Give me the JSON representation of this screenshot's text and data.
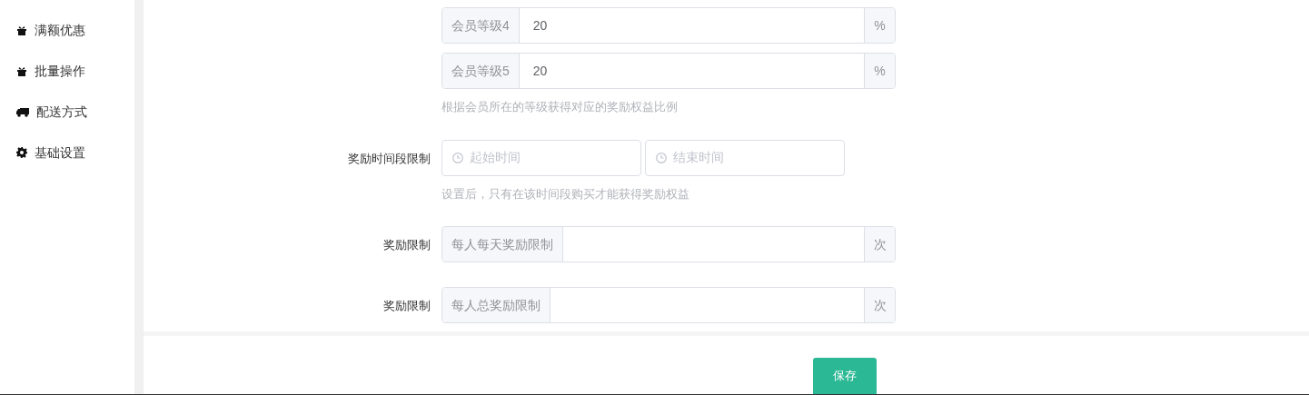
{
  "sidebar": {
    "items": [
      {
        "label": "满额优惠"
      },
      {
        "label": "批量操作"
      },
      {
        "label": "配送方式"
      },
      {
        "label": "基础设置"
      }
    ]
  },
  "member_levels": [
    {
      "prefix": "会员等级4",
      "value": "20",
      "suffix": "%"
    },
    {
      "prefix": "会员等级5",
      "value": "20",
      "suffix": "%"
    }
  ],
  "member_hint": "根据会员所在的等级获得对应的奖励权益比例",
  "time_limit": {
    "label": "奖励时间段限制",
    "start_placeholder": "起始时间",
    "end_placeholder": "结束时间",
    "hint": "设置后，只有在该时间段购买才能获得奖励权益"
  },
  "limits": [
    {
      "label": "奖励限制",
      "prefix": "每人每天奖励限制",
      "suffix": "次"
    },
    {
      "label": "奖励限制",
      "prefix": "每人总奖励限制",
      "suffix": "次"
    }
  ],
  "save_button": "保存"
}
